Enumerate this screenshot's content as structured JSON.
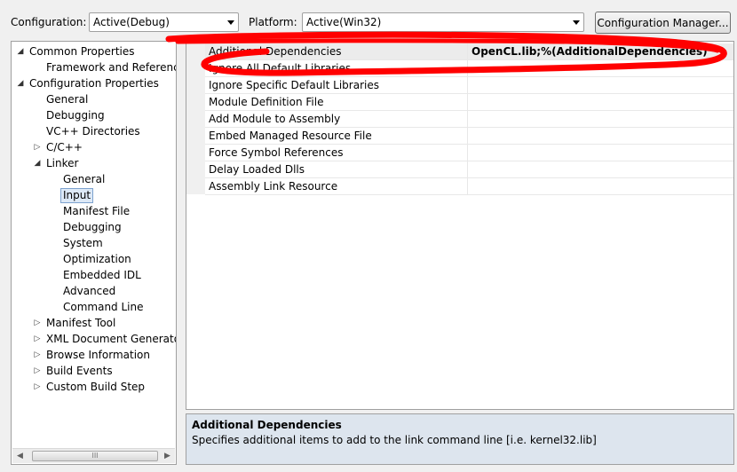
{
  "toolbar": {
    "configuration_label": "Configuration:",
    "configuration_value": "Active(Debug)",
    "platform_label": "Platform:",
    "platform_value": "Active(Win32)",
    "config_manager_button": "Configuration Manager..."
  },
  "tree": {
    "items": [
      {
        "label": "Common Properties",
        "toggle": "◢"
      },
      {
        "label": "Framework and References",
        "toggle": ""
      },
      {
        "label": "Configuration Properties",
        "toggle": "◢"
      },
      {
        "label": "General",
        "toggle": ""
      },
      {
        "label": "Debugging",
        "toggle": ""
      },
      {
        "label": "VC++ Directories",
        "toggle": ""
      },
      {
        "label": "C/C++",
        "toggle": "▷"
      },
      {
        "label": "Linker",
        "toggle": "◢"
      },
      {
        "label": "General",
        "toggle": ""
      },
      {
        "label": "Input",
        "toggle": ""
      },
      {
        "label": "Manifest File",
        "toggle": ""
      },
      {
        "label": "Debugging",
        "toggle": ""
      },
      {
        "label": "System",
        "toggle": ""
      },
      {
        "label": "Optimization",
        "toggle": ""
      },
      {
        "label": "Embedded IDL",
        "toggle": ""
      },
      {
        "label": "Advanced",
        "toggle": ""
      },
      {
        "label": "Command Line",
        "toggle": ""
      },
      {
        "label": "Manifest Tool",
        "toggle": "▷"
      },
      {
        "label": "XML Document Generator",
        "toggle": "▷"
      },
      {
        "label": "Browse Information",
        "toggle": "▷"
      },
      {
        "label": "Build Events",
        "toggle": "▷"
      },
      {
        "label": "Custom Build Step",
        "toggle": "▷"
      }
    ],
    "scroll_left": "◀",
    "scroll_right": "▶",
    "scroll_grip": "III"
  },
  "grid": {
    "rows": [
      {
        "name": "Additional Dependencies",
        "value": "OpenCL.lib;%(AdditionalDependencies)"
      },
      {
        "name": "Ignore All Default Libraries",
        "value": ""
      },
      {
        "name": "Ignore Specific Default Libraries",
        "value": ""
      },
      {
        "name": "Module Definition File",
        "value": ""
      },
      {
        "name": "Add Module to Assembly",
        "value": ""
      },
      {
        "name": "Embed Managed Resource File",
        "value": ""
      },
      {
        "name": "Force Symbol References",
        "value": ""
      },
      {
        "name": "Delay Loaded Dlls",
        "value": ""
      },
      {
        "name": "Assembly Link Resource",
        "value": ""
      }
    ]
  },
  "description": {
    "title": "Additional Dependencies",
    "body": "Specifies additional items to add to the link command line [i.e. kernel32.lib]"
  },
  "colors": {
    "annotation": "#ff0000",
    "selection_bg": "#dde9f7",
    "description_bg": "#dde5ee"
  }
}
